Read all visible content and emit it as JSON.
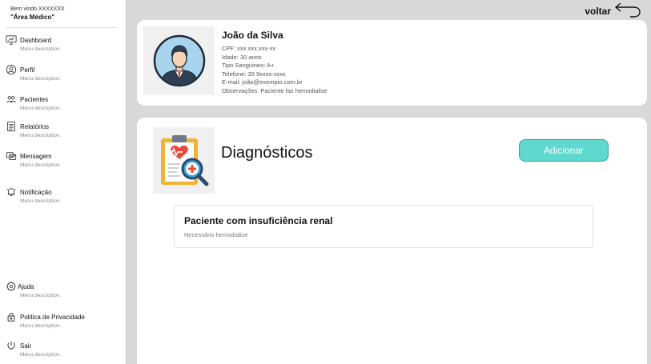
{
  "sidebar": {
    "welcome": "Bem vindo XXXXXXX",
    "area": "\"Área Médico\"",
    "items": [
      {
        "label": "Dashboard",
        "desc": "Menu description.",
        "icon": "dashboard-icon"
      },
      {
        "label": "Perfil",
        "desc": "Menu description.",
        "icon": "profile-icon"
      },
      {
        "label": "Pacientes",
        "desc": "Menu description.",
        "icon": "patients-icon"
      },
      {
        "label": "Relatórios",
        "desc": "Menu description.",
        "icon": "reports-icon"
      },
      {
        "label": "Mensagem",
        "desc": "Menu description.",
        "icon": "message-icon"
      },
      {
        "label": "Notificação",
        "desc": "Menu description.",
        "icon": "bell-icon"
      }
    ],
    "bottom_items": [
      {
        "label": "Ajuda",
        "desc": "Menu description.",
        "icon": "help-icon"
      },
      {
        "label": "Politica de Privacidade",
        "desc": "Menu description.",
        "icon": "lock-icon"
      },
      {
        "label": "Sair",
        "desc": "Menu description.",
        "icon": "power-icon"
      }
    ]
  },
  "header": {
    "back_label": "voltar"
  },
  "patient": {
    "name": "João da Silva",
    "cpf": "CPF: xxx.xxx.xxx-xx",
    "age": "Idade: 30 anos",
    "blood": "Tipo Sanguineo: A+",
    "phone": "Telefone: 35 9xxxx-xxxx",
    "email": "E-mail: joão@exempio.com.br",
    "notes": "Observações: Paciente faz hemodialise"
  },
  "diagnostics": {
    "title": "Diagnósticos",
    "add_label": "Adicionar",
    "items": [
      {
        "title": "Paciente com insuficiência renal",
        "desc": "Necessário hemodialise"
      }
    ]
  },
  "colors": {
    "accent": "#5fd8d0",
    "background": "#d9d9d9"
  }
}
